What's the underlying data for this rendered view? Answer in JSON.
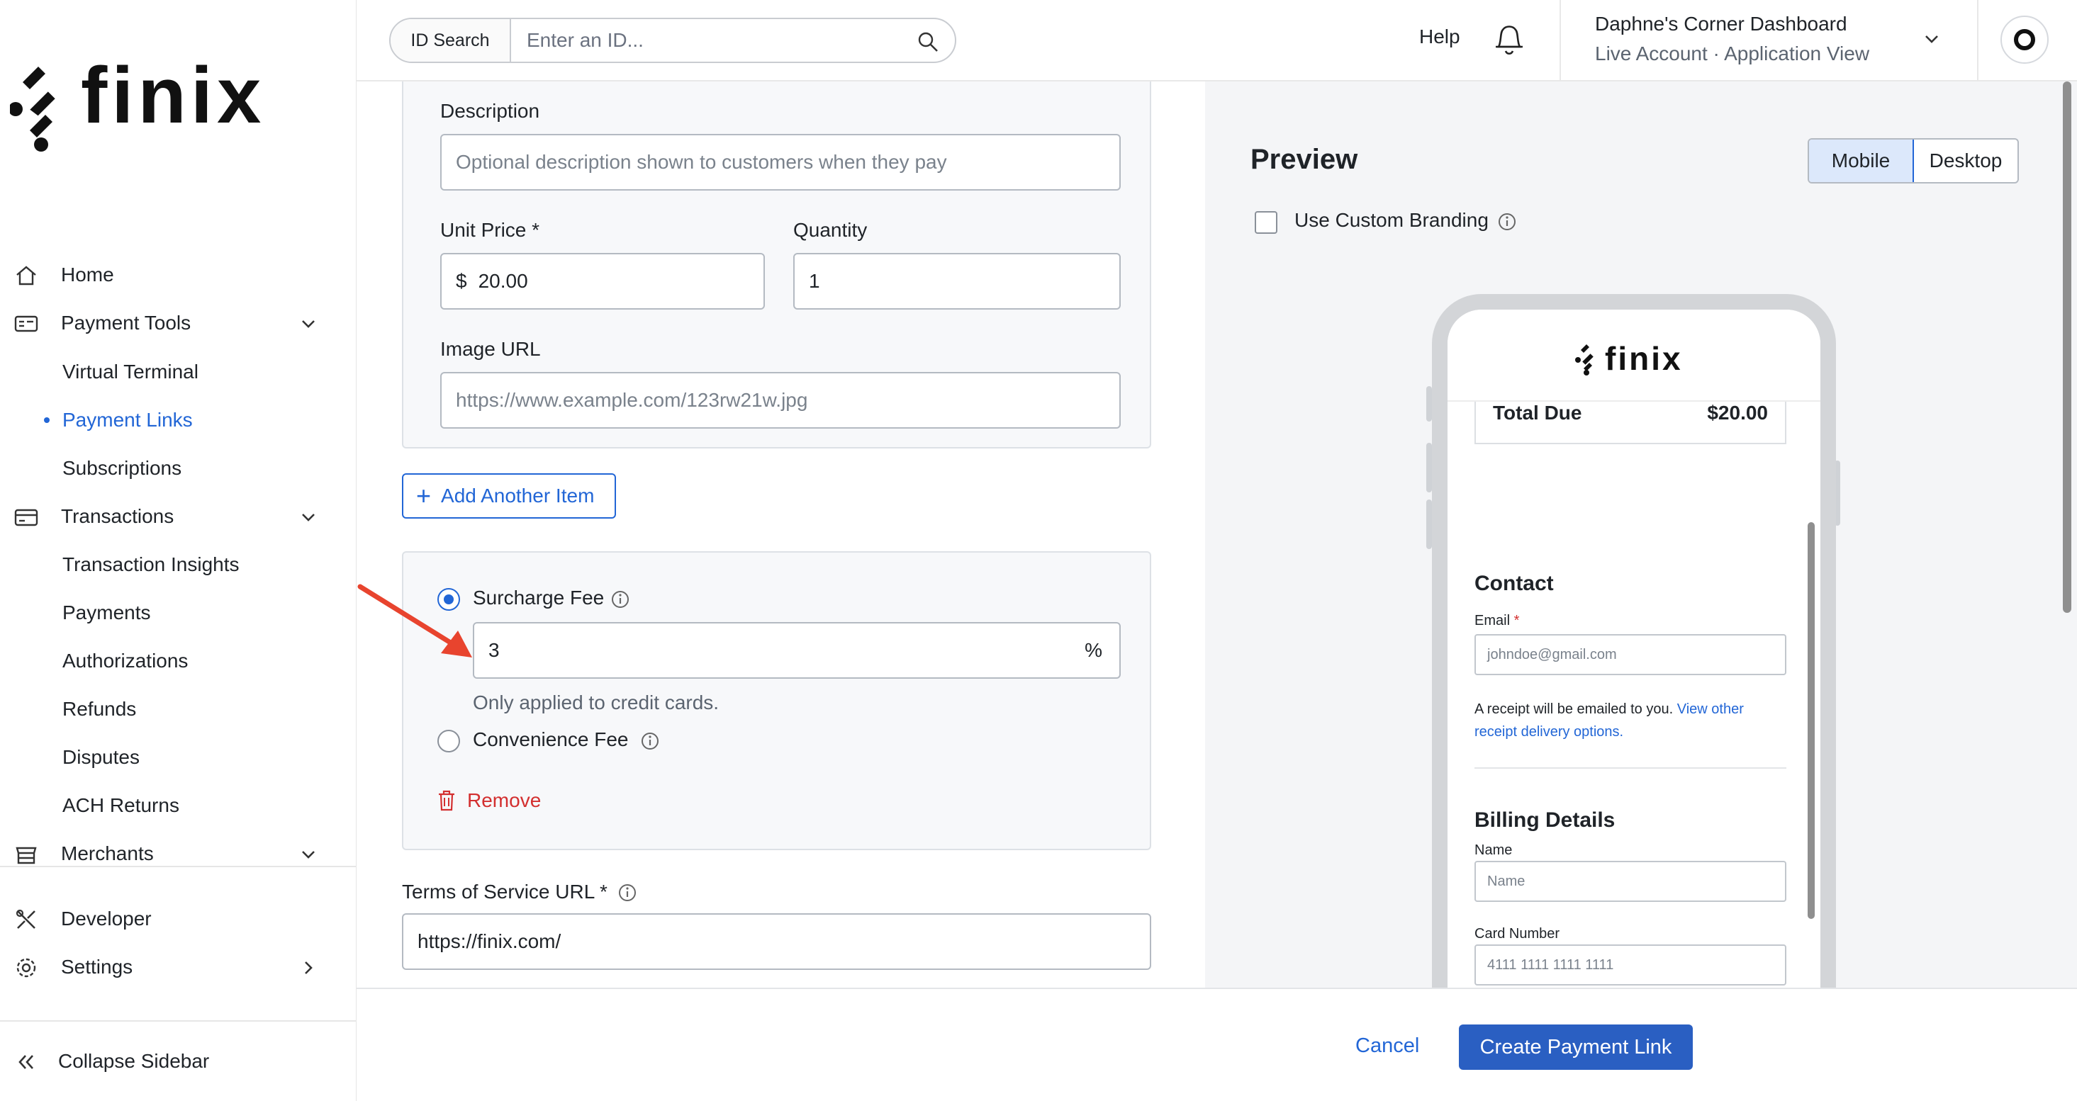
{
  "brand": {
    "logo_text": "finix",
    "accent_color": "#2266d6",
    "danger_color": "#d32f2f",
    "primary_button_color": "#2a5fc2"
  },
  "topbar": {
    "id_search_label": "ID Search",
    "id_search_placeholder": "Enter an ID...",
    "help_label": "Help",
    "account_name": "Daphne's Corner Dashboard",
    "account_sub": "Live Account  ·  Application View",
    "icons": [
      "search-icon",
      "bell-icon",
      "chevron-down-icon",
      "avatar"
    ]
  },
  "sidebar": {
    "items": [
      {
        "label": "Home",
        "icon": "home-icon"
      },
      {
        "label": "Payment Tools",
        "icon": "payment-tools-icon"
      },
      {
        "label": "Transactions",
        "icon": "transactions-icon"
      },
      {
        "label": "Merchants",
        "icon": "merchants-icon"
      },
      {
        "label": "Developer",
        "icon": "developer-icon"
      },
      {
        "label": "Settings",
        "icon": "gear-icon"
      }
    ],
    "payment_tools_sub": [
      "Virtual Terminal",
      "Payment Links",
      "Subscriptions"
    ],
    "transactions_sub": [
      "Transaction Insights",
      "Payments",
      "Authorizations",
      "Refunds",
      "Disputes",
      "ACH Returns"
    ],
    "active_item": "Payment Links",
    "collapse_label": "Collapse Sidebar"
  },
  "form": {
    "description_label": "Description",
    "description_placeholder": "Optional description shown to customers when they pay",
    "unit_price_label": "Unit Price *",
    "unit_price_symbol": "$",
    "unit_price_value": "20.00",
    "quantity_label": "Quantity",
    "quantity_value": "1",
    "image_url_label": "Image URL",
    "image_url_placeholder": "https://www.example.com/123rw21w.jpg",
    "add_item_label": "Add Another Item",
    "surcharge_label": "Surcharge Fee",
    "surcharge_value": "3",
    "surcharge_unit": "%",
    "surcharge_help": "Only applied to credit cards.",
    "convenience_label": "Convenience Fee",
    "remove_label": "Remove",
    "tos_label": "Terms of Service URL *",
    "tos_value": "https://finix.com/"
  },
  "preview": {
    "title": "Preview",
    "mobile_label": "Mobile",
    "desktop_label": "Desktop",
    "selected_view": "Mobile",
    "custom_branding_label": "Use Custom Branding",
    "phone": {
      "logo_text": "finix",
      "total_label": "Total Due",
      "total_value": "$20.00",
      "contact_title": "Contact",
      "email_label": "Email",
      "email_required": "*",
      "email_placeholder": "johndoe@gmail.com",
      "receipt_text": "A receipt will be emailed to you.",
      "receipt_link_1": "View other",
      "receipt_link_2": "receipt delivery options.",
      "billing_title": "Billing Details",
      "name_label": "Name",
      "name_placeholder": "Name",
      "card_label": "Card Number",
      "card_placeholder": "4111 1111 1111 1111"
    }
  },
  "footer": {
    "cancel_label": "Cancel",
    "create_label": "Create Payment Link"
  }
}
